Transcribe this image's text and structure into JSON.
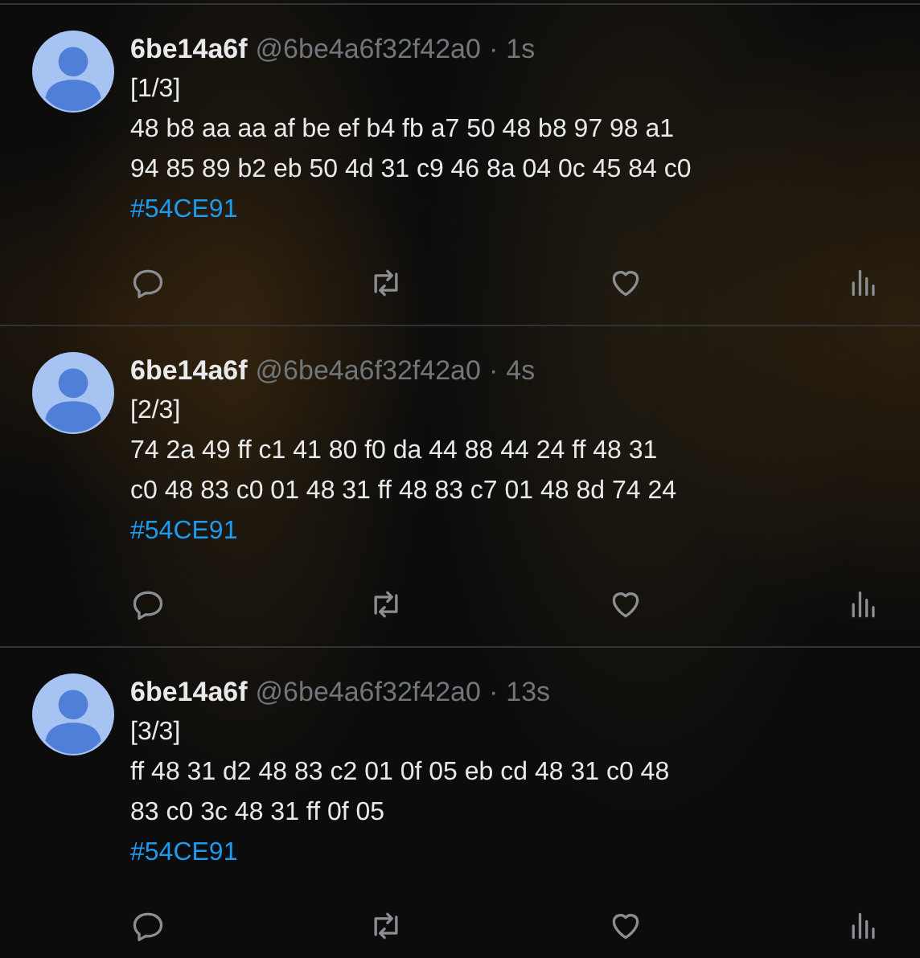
{
  "posts": [
    {
      "display_name": "6be14a6f",
      "handle": "@6be4a6f32f42a0",
      "separator": "·",
      "time": "1s",
      "thread_marker": "[1/3]",
      "body_lines": [
        "48 b8 aa aa af be ef b4 fb a7 50 48 b8 97 98 a1",
        "94 85 89 b2 eb 50 4d 31 c9 46 8a 04 0c 45 84 c0"
      ],
      "hashtag": "#54CE91"
    },
    {
      "display_name": "6be14a6f",
      "handle": "@6be4a6f32f42a0",
      "separator": "·",
      "time": "4s",
      "thread_marker": "[2/3]",
      "body_lines": [
        "74 2a 49 ff c1 41 80 f0 da 44 88 44 24 ff 48 31",
        "c0 48 83 c0 01 48 31 ff 48 83 c7 01 48 8d 74 24"
      ],
      "hashtag": "#54CE91"
    },
    {
      "display_name": "6be14a6f",
      "handle": "@6be4a6f32f42a0",
      "separator": "·",
      "time": "13s",
      "thread_marker": "[3/3]",
      "body_lines": [
        "ff 48 31 d2 48 83 c2 01 0f 05 eb cd 48 31 c0 48",
        "83 c0 3c 48 31 ff 0f 05"
      ],
      "hashtag": "#54CE91"
    }
  ]
}
